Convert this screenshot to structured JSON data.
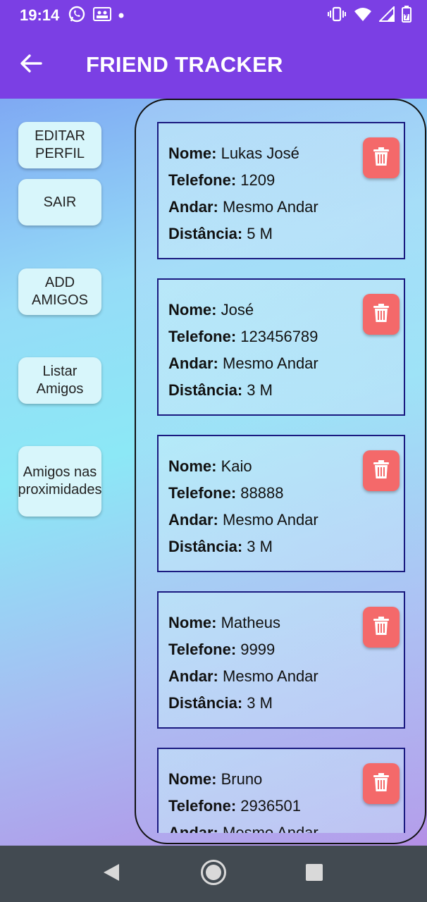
{
  "status_bar": {
    "time": "19:14",
    "icons": [
      "whatsapp-icon",
      "contacts-icon",
      "dot-icon",
      "vibrate-icon",
      "wifi-icon",
      "signal-icon",
      "battery-icon"
    ]
  },
  "app_bar": {
    "title": "FRIEND TRACKER"
  },
  "sidebar": {
    "buttons": [
      {
        "label": "EDITAR PERFIL"
      },
      {
        "label": "SAIR"
      },
      {
        "label": "ADD AMIGOS"
      },
      {
        "label": "Listar Amigos"
      },
      {
        "label": "Amigos nas proximidades"
      }
    ]
  },
  "labels": {
    "name": "Nome:",
    "phone": "Telefone:",
    "floor": "Andar:",
    "distance": "Distância:"
  },
  "friends": [
    {
      "name": "Lukas José",
      "phone": "1209",
      "floor": "Mesmo Andar",
      "distance": "5 M"
    },
    {
      "name": "José",
      "phone": "123456789",
      "floor": "Mesmo Andar",
      "distance": "3 M"
    },
    {
      "name": "Kaio",
      "phone": "88888",
      "floor": "Mesmo Andar",
      "distance": "3 M"
    },
    {
      "name": "Matheus",
      "phone": "9999",
      "floor": "Mesmo Andar",
      "distance": "3 M"
    },
    {
      "name": "Bruno",
      "phone": "2936501",
      "floor": "Mesmo Andar",
      "distance": ""
    }
  ],
  "colors": {
    "app_bar": "#7b3fe4",
    "delete_button": "#f4696a",
    "nav_bar": "#424a51"
  }
}
